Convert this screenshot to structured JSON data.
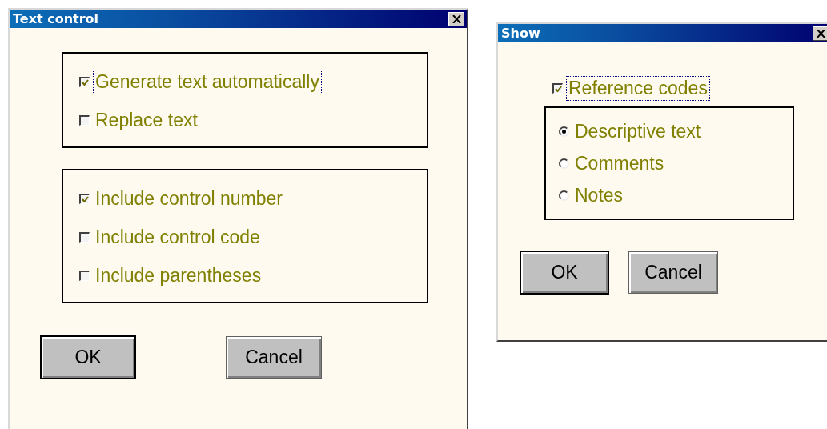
{
  "dialogs": [
    {
      "title": "Text control",
      "groups": [
        {
          "items": [
            {
              "kind": "checkbox",
              "label": "Generate text automatically",
              "checked": true,
              "focused": true
            },
            {
              "kind": "checkbox",
              "label": "Replace text",
              "checked": false,
              "focused": false
            }
          ]
        },
        {
          "items": [
            {
              "kind": "checkbox",
              "label": "Include control number",
              "checked": true,
              "focused": false
            },
            {
              "kind": "checkbox",
              "label": "Include control code",
              "checked": false,
              "focused": false
            },
            {
              "kind": "checkbox",
              "label": "Include parentheses",
              "checked": false,
              "focused": false
            }
          ]
        }
      ],
      "buttons": [
        {
          "label": "OK",
          "default": true
        },
        {
          "label": "Cancel",
          "default": false
        }
      ]
    },
    {
      "title": "Show",
      "top_items": [
        {
          "kind": "checkbox",
          "label": "Reference codes",
          "checked": true,
          "focused": true
        }
      ],
      "groups": [
        {
          "items": [
            {
              "kind": "radio",
              "label": "Descriptive text",
              "selected": true,
              "focused": false
            },
            {
              "kind": "radio",
              "label": "Comments",
              "selected": false,
              "focused": false
            },
            {
              "kind": "radio",
              "label": "Notes",
              "selected": false,
              "focused": false
            }
          ]
        }
      ],
      "buttons": [
        {
          "label": "OK",
          "default": true
        },
        {
          "label": "Cancel",
          "default": false
        }
      ]
    }
  ]
}
